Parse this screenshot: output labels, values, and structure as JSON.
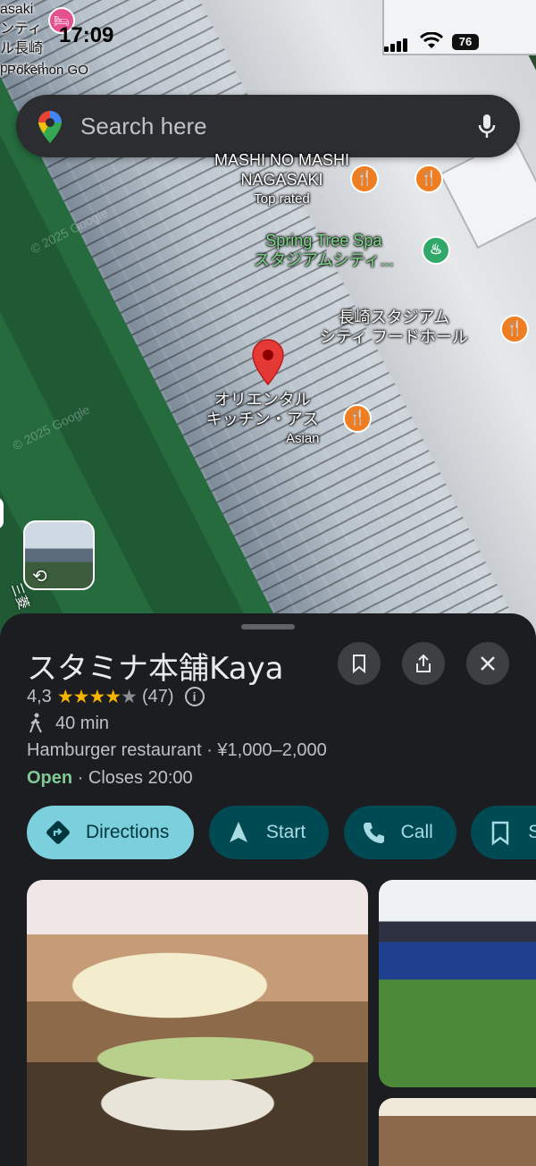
{
  "status_bar": {
    "time": "17:09",
    "back_app": "Pokemon GO",
    "battery": "76",
    "left_edge_labels": [
      "asaki",
      "ンティ",
      "ル長崎",
      "p rated"
    ]
  },
  "search": {
    "placeholder": "Search here"
  },
  "map": {
    "pois": [
      {
        "name": "MASHI NO MASHI\nNAGASAKI",
        "sub": "Top rated"
      },
      {
        "name": "Spring Tree Spa\nスタジアムシティ..."
      },
      {
        "name": "長崎スタジアム\nシティ フードホール"
      },
      {
        "name": "オリエンタル\nキッチン・アス",
        "sub": "Asian"
      }
    ],
    "watermarks": [
      "© 2025 Google",
      "© 2025 Google"
    ],
    "side_label": "三菱",
    "icons": [
      "food-icon",
      "spa-icon",
      "hotel-icon",
      "street-view-icon",
      "red-pin-icon"
    ]
  },
  "place": {
    "name": "スタミナ本舗Kaya",
    "rating": "4,3",
    "stars": 4.3,
    "reviews": "(47)",
    "walk_time": "40 min",
    "category": "Hamburger restaurant · ¥1,000–2,000",
    "open_status": "Open",
    "closes": " · Closes 20:00"
  },
  "actions": [
    {
      "label": "Directions",
      "icon": "directions-icon"
    },
    {
      "label": "Start",
      "icon": "navigation-icon"
    },
    {
      "label": "Call",
      "icon": "phone-icon"
    },
    {
      "label": "Sa",
      "icon": "bookmark-icon"
    }
  ],
  "colors": {
    "accent": "#7ccfdc",
    "chip_bg": "#004a53",
    "open_green": "#81c995",
    "star": "#f6b400",
    "sheet_bg": "#1b1d21"
  }
}
